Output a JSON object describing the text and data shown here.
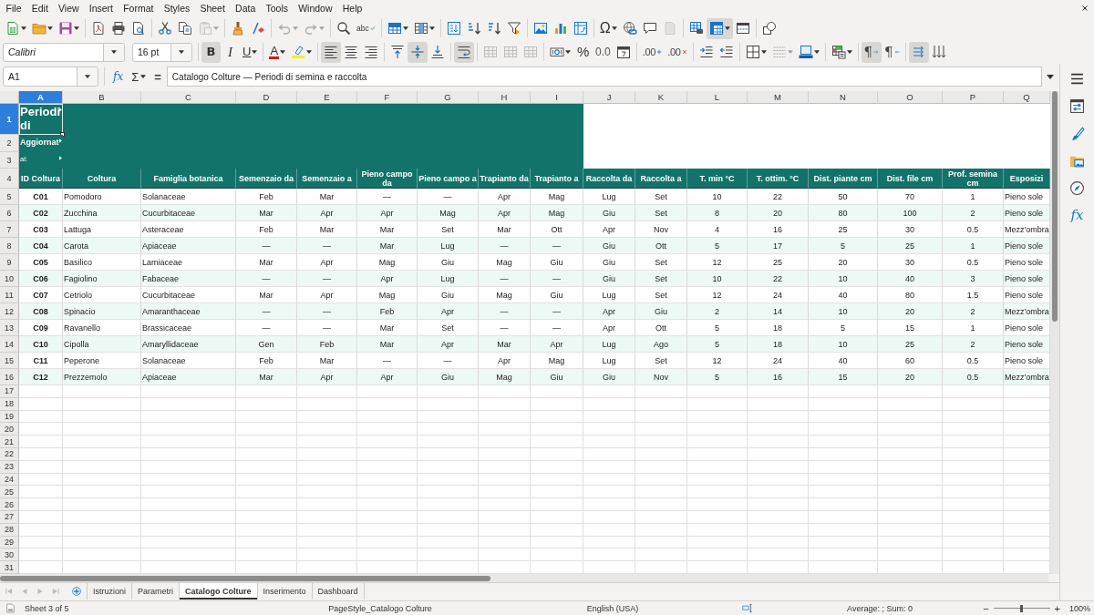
{
  "menu_bar": [
    "File",
    "Edit",
    "View",
    "Insert",
    "Format",
    "Styles",
    "Sheet",
    "Data",
    "Tools",
    "Window",
    "Help"
  ],
  "standard_toolbar": {
    "groups": [
      [
        {
          "kind": "new",
          "on": false,
          "disabled": false,
          "menu": true
        },
        {
          "kind": "open",
          "on": false,
          "disabled": false,
          "menu": true
        },
        {
          "kind": "save",
          "on": false,
          "disabled": false,
          "menu": true
        }
      ],
      [
        {
          "kind": "export-pdf",
          "on": false,
          "disabled": false,
          "menu": false
        },
        {
          "kind": "print",
          "on": false,
          "disabled": false,
          "menu": false
        },
        {
          "kind": "print-preview",
          "on": false,
          "disabled": false,
          "menu": false
        }
      ],
      [
        {
          "kind": "cut",
          "on": false,
          "disabled": false,
          "menu": false
        },
        {
          "kind": "copy",
          "on": false,
          "disabled": false,
          "menu": false
        },
        {
          "kind": "paste",
          "on": false,
          "disabled": true,
          "menu": true
        }
      ],
      [
        {
          "kind": "clone",
          "on": false,
          "disabled": false,
          "menu": false
        },
        {
          "kind": "clear-format",
          "on": false,
          "disabled": false,
          "menu": false
        }
      ],
      [
        {
          "kind": "undo",
          "on": false,
          "disabled": true,
          "menu": true
        },
        {
          "kind": "redo",
          "on": false,
          "disabled": true,
          "menu": true
        }
      ],
      [
        {
          "kind": "find-replace",
          "on": false,
          "disabled": false,
          "menu": false
        },
        {
          "kind": "spelling",
          "glyph": "abc",
          "on": false,
          "disabled": false,
          "menu": false
        }
      ],
      [
        {
          "kind": "insert-rows",
          "on": false,
          "disabled": false,
          "menu": true
        },
        {
          "kind": "insert-columns",
          "on": false,
          "disabled": false,
          "menu": true
        }
      ],
      [
        {
          "kind": "sort",
          "on": false,
          "disabled": false,
          "menu": false
        },
        {
          "kind": "sort-asc",
          "on": false,
          "disabled": false,
          "menu": false
        },
        {
          "kind": "sort-desc",
          "on": false,
          "disabled": false,
          "menu": false
        },
        {
          "kind": "autofilter",
          "on": false,
          "disabled": false,
          "menu": false
        }
      ],
      [
        {
          "kind": "image",
          "on": false,
          "disabled": false,
          "menu": false
        },
        {
          "kind": "chart",
          "on": false,
          "disabled": false,
          "menu": false
        },
        {
          "kind": "pivot-table",
          "on": false,
          "disabled": false,
          "menu": false
        }
      ],
      [
        {
          "kind": "special-char",
          "glyph": "Ω",
          "on": false,
          "disabled": false,
          "menu": true
        },
        {
          "kind": "hyperlink",
          "on": false,
          "disabled": false,
          "menu": false
        },
        {
          "kind": "comment",
          "on": false,
          "disabled": false,
          "menu": false
        },
        {
          "kind": "header-footer",
          "on": false,
          "disabled": true,
          "menu": false
        }
      ],
      [
        {
          "kind": "print-area",
          "on": false,
          "disabled": false,
          "menu": false
        },
        {
          "kind": "freeze",
          "on": true,
          "disabled": false,
          "menu": true
        },
        {
          "kind": "split-window",
          "on": false,
          "disabled": false,
          "menu": false
        }
      ],
      [
        {
          "kind": "shapes",
          "on": false,
          "disabled": false,
          "menu": false
        }
      ]
    ]
  },
  "formatting_toolbar": {
    "font_name": "Calibri",
    "font_size": "16 pt",
    "groups": [
      [
        {
          "kind": "bold",
          "glyph": "B",
          "on": true,
          "disabled": false,
          "menu": false
        },
        {
          "kind": "italic",
          "glyph": "I",
          "on": false,
          "disabled": false,
          "menu": false
        },
        {
          "kind": "underline",
          "glyph": "U",
          "on": false,
          "disabled": false,
          "menu": true
        }
      ],
      [
        {
          "kind": "font-color",
          "glyph": "A",
          "on": false,
          "disabled": false,
          "menu": true
        },
        {
          "kind": "highlight",
          "on": false,
          "disabled": false,
          "menu": true
        }
      ],
      [
        {
          "kind": "align-left",
          "on": true,
          "disabled": false,
          "menu": false
        },
        {
          "kind": "align-center",
          "on": false,
          "disabled": false,
          "menu": false
        },
        {
          "kind": "align-right",
          "on": false,
          "disabled": false,
          "menu": false
        }
      ],
      [
        {
          "kind": "align-top",
          "on": false,
          "disabled": false,
          "menu": false
        },
        {
          "kind": "align-middle",
          "on": true,
          "disabled": false,
          "menu": false
        },
        {
          "kind": "align-bottom",
          "on": false,
          "disabled": false,
          "menu": false
        }
      ],
      [
        {
          "kind": "wrap-text",
          "on": true,
          "disabled": false,
          "menu": false
        }
      ],
      [
        {
          "kind": "merge-center",
          "on": false,
          "disabled": true,
          "menu": false
        },
        {
          "kind": "merge",
          "on": false,
          "disabled": true,
          "menu": false
        },
        {
          "kind": "unmerge",
          "on": false,
          "disabled": true,
          "menu": false
        }
      ],
      [
        {
          "kind": "currency",
          "on": false,
          "disabled": false,
          "menu": true
        },
        {
          "kind": "percent",
          "glyph": "%",
          "on": false,
          "disabled": false,
          "menu": false
        },
        {
          "kind": "number",
          "glyph": "0.0",
          "on": false,
          "disabled": false,
          "menu": false
        },
        {
          "kind": "date",
          "on": false,
          "disabled": false,
          "menu": false
        }
      ],
      [
        {
          "kind": "add-decimal",
          "glyph": ".00",
          "on": false,
          "disabled": false,
          "menu": false
        },
        {
          "kind": "delete-decimal",
          "glyph": ".00",
          "on": false,
          "disabled": false,
          "menu": false
        }
      ],
      [
        {
          "kind": "indent-increase",
          "on": false,
          "disabled": false,
          "menu": false
        },
        {
          "kind": "indent-decrease",
          "on": false,
          "disabled": false,
          "menu": false
        }
      ],
      [
        {
          "kind": "borders",
          "on": false,
          "disabled": false,
          "menu": true
        },
        {
          "kind": "border-style",
          "on": false,
          "disabled": true,
          "menu": true
        },
        {
          "kind": "border-color",
          "on": false,
          "disabled": false,
          "menu": true
        }
      ],
      [
        {
          "kind": "conditional",
          "on": false,
          "disabled": false,
          "menu": true
        }
      ],
      [
        {
          "kind": "ltr",
          "glyph": "¶",
          "on": true,
          "disabled": false,
          "menu": false
        },
        {
          "kind": "rtl",
          "glyph": "¶",
          "on": false,
          "disabled": false,
          "menu": false
        }
      ],
      [
        {
          "kind": "text-direction",
          "on": true,
          "disabled": false,
          "menu": false
        },
        {
          "kind": "vertical-text",
          "on": false,
          "disabled": false,
          "menu": false
        }
      ]
    ]
  },
  "formula_bar": {
    "name_box": "A1",
    "function_wizard": "fx",
    "sum": "Σ",
    "equals": "=",
    "content": "Catalogo Colture — Periodi di semina e raccolta"
  },
  "sheet": {
    "columns": [
      {
        "label": "A",
        "selected": true
      },
      {
        "label": "B",
        "selected": false
      },
      {
        "label": "C",
        "selected": false
      },
      {
        "label": "D",
        "selected": false
      },
      {
        "label": "E",
        "selected": false
      },
      {
        "label": "F",
        "selected": false
      },
      {
        "label": "G",
        "selected": false
      },
      {
        "label": "H",
        "selected": false
      },
      {
        "label": "I",
        "selected": false
      },
      {
        "label": "J",
        "selected": false
      },
      {
        "label": "K",
        "selected": false
      },
      {
        "label": "L",
        "selected": false
      },
      {
        "label": "M",
        "selected": false
      },
      {
        "label": "N",
        "selected": false
      },
      {
        "label": "O",
        "selected": false
      },
      {
        "label": "P",
        "selected": false
      },
      {
        "label": "Q",
        "selected": false
      }
    ],
    "row_numbers": [
      {
        "label": "1",
        "selected": true
      },
      {
        "label": "2",
        "selected": false
      },
      {
        "label": "3",
        "selected": false
      },
      {
        "label": "4",
        "selected": false
      },
      {
        "label": "5",
        "selected": false
      },
      {
        "label": "6",
        "selected": false
      },
      {
        "label": "7",
        "selected": false
      },
      {
        "label": "8",
        "selected": false
      },
      {
        "label": "9",
        "selected": false
      },
      {
        "label": "10",
        "selected": false
      },
      {
        "label": "11",
        "selected": false
      },
      {
        "label": "12",
        "selected": false
      },
      {
        "label": "13",
        "selected": false
      },
      {
        "label": "14",
        "selected": false
      },
      {
        "label": "15",
        "selected": false
      },
      {
        "label": "16",
        "selected": false
      },
      {
        "label": "17",
        "selected": false
      },
      {
        "label": "18",
        "selected": false
      },
      {
        "label": "19",
        "selected": false
      },
      {
        "label": "20",
        "selected": false
      },
      {
        "label": "21",
        "selected": false
      },
      {
        "label": "22",
        "selected": false
      },
      {
        "label": "23",
        "selected": false
      },
      {
        "label": "24",
        "selected": false
      },
      {
        "label": "25",
        "selected": false
      },
      {
        "label": "26",
        "selected": false
      },
      {
        "label": "27",
        "selected": false
      },
      {
        "label": "28",
        "selected": false
      },
      {
        "label": "29",
        "selected": false
      },
      {
        "label": "30",
        "selected": false
      },
      {
        "label": "31",
        "selected": false
      }
    ],
    "title_cells": [
      {
        "text": "Periodi di",
        "overflow": true
      },
      {
        "text": "Aggiornat",
        "overflow": true
      },
      {
        "text": "al:",
        "overflow": true
      }
    ],
    "header": [
      "ID Coltura",
      "Coltura",
      "Famiglia botanica",
      "Semenzaio da",
      "Semenzaio a",
      "Pieno campo da",
      "Pieno campo a",
      "Trapianto da",
      "Trapianto a",
      "Raccolta da",
      "Raccolta a",
      "T. min °C",
      "T. ottim. °C",
      "Dist. piante cm",
      "Dist. file cm",
      "Prof. semina cm",
      "Esposizi"
    ],
    "rows": [
      [
        "C01",
        "Pomodoro",
        "Solanaceae",
        "Feb",
        "Mar",
        "—",
        "—",
        "Apr",
        "Mag",
        "Lug",
        "Set",
        "10",
        "22",
        "50",
        "70",
        "1",
        "Pieno sole"
      ],
      [
        "C02",
        "Zucchina",
        "Cucurbitaceae",
        "Mar",
        "Apr",
        "Apr",
        "Mag",
        "Apr",
        "Mag",
        "Giu",
        "Set",
        "8",
        "20",
        "80",
        "100",
        "2",
        "Pieno sole"
      ],
      [
        "C03",
        "Lattuga",
        "Asteraceae",
        "Feb",
        "Mar",
        "Mar",
        "Set",
        "Mar",
        "Ott",
        "Apr",
        "Nov",
        "4",
        "16",
        "25",
        "30",
        "0.5",
        "Mezz'ombra"
      ],
      [
        "C04",
        "Carota",
        "Apiaceae",
        "—",
        "—",
        "Mar",
        "Lug",
        "—",
        "—",
        "Giu",
        "Ott",
        "5",
        "17",
        "5",
        "25",
        "1",
        "Pieno sole"
      ],
      [
        "C05",
        "Basilico",
        "Lamiaceae",
        "Mar",
        "Apr",
        "Mag",
        "Giu",
        "Mag",
        "Giu",
        "Giu",
        "Set",
        "12",
        "25",
        "20",
        "30",
        "0.5",
        "Pieno sole"
      ],
      [
        "C06",
        "Fagiolino",
        "Fabaceae",
        "—",
        "—",
        "Apr",
        "Lug",
        "—",
        "—",
        "Giu",
        "Set",
        "10",
        "22",
        "10",
        "40",
        "3",
        "Pieno sole"
      ],
      [
        "C07",
        "Cetriolo",
        "Cucurbitaceae",
        "Mar",
        "Apr",
        "Mag",
        "Giu",
        "Mag",
        "Giu",
        "Lug",
        "Set",
        "12",
        "24",
        "40",
        "80",
        "1.5",
        "Pieno sole"
      ],
      [
        "C08",
        "Spinacio",
        "Amaranthaceae",
        "—",
        "—",
        "Feb",
        "Apr",
        "—",
        "—",
        "Apr",
        "Giu",
        "2",
        "14",
        "10",
        "20",
        "2",
        "Mezz'ombra"
      ],
      [
        "C09",
        "Ravanello",
        "Brassicaceae",
        "—",
        "—",
        "Mar",
        "Set",
        "—",
        "—",
        "Apr",
        "Ott",
        "5",
        "18",
        "5",
        "15",
        "1",
        "Pieno sole"
      ],
      [
        "C10",
        "Cipolla",
        "Amaryllidaceae",
        "Gen",
        "Feb",
        "Mar",
        "Apr",
        "Mar",
        "Apr",
        "Lug",
        "Ago",
        "5",
        "18",
        "10",
        "25",
        "2",
        "Pieno sole"
      ],
      [
        "C11",
        "Peperone",
        "Solanaceae",
        "Feb",
        "Mar",
        "—",
        "—",
        "Apr",
        "Mag",
        "Lug",
        "Set",
        "12",
        "24",
        "40",
        "60",
        "0.5",
        "Pieno sole"
      ],
      [
        "C12",
        "Prezzemolo",
        "Apiaceae",
        "Mar",
        "Apr",
        "Apr",
        "Giu",
        "Mag",
        "Giu",
        "Giu",
        "Nov",
        "5",
        "16",
        "15",
        "20",
        "0.5",
        "Mezz'ombra"
      ]
    ]
  },
  "sheet_tabs": {
    "nav_buttons": [
      {
        "kind": "first",
        "disabled": true
      },
      {
        "kind": "prev",
        "disabled": true
      },
      {
        "kind": "next",
        "disabled": true
      },
      {
        "kind": "last",
        "disabled": true
      }
    ],
    "tabs": [
      {
        "label": "Istruzioni",
        "selected": false
      },
      {
        "label": "Parametri",
        "selected": false
      },
      {
        "label": "Catalogo Colture",
        "selected": true
      },
      {
        "label": "Inserimento",
        "selected": false
      },
      {
        "label": "Dashboard",
        "selected": false
      }
    ]
  },
  "sidebar": {
    "items": [
      {
        "kind": "properties"
      },
      {
        "kind": "styles"
      },
      {
        "kind": "gallery"
      },
      {
        "kind": "navigator"
      },
      {
        "kind": "functions",
        "glyph": "fx"
      }
    ]
  },
  "status_bar": {
    "sheet": "Sheet 3 of 5",
    "page_style": "PageStyle_Catalogo Colture",
    "language": "English (USA)",
    "selection_summary": "Average: ; Sum: 0",
    "zoom": {
      "minus": "−",
      "plus": "+",
      "level": 0.5,
      "reading": "100%"
    }
  }
}
